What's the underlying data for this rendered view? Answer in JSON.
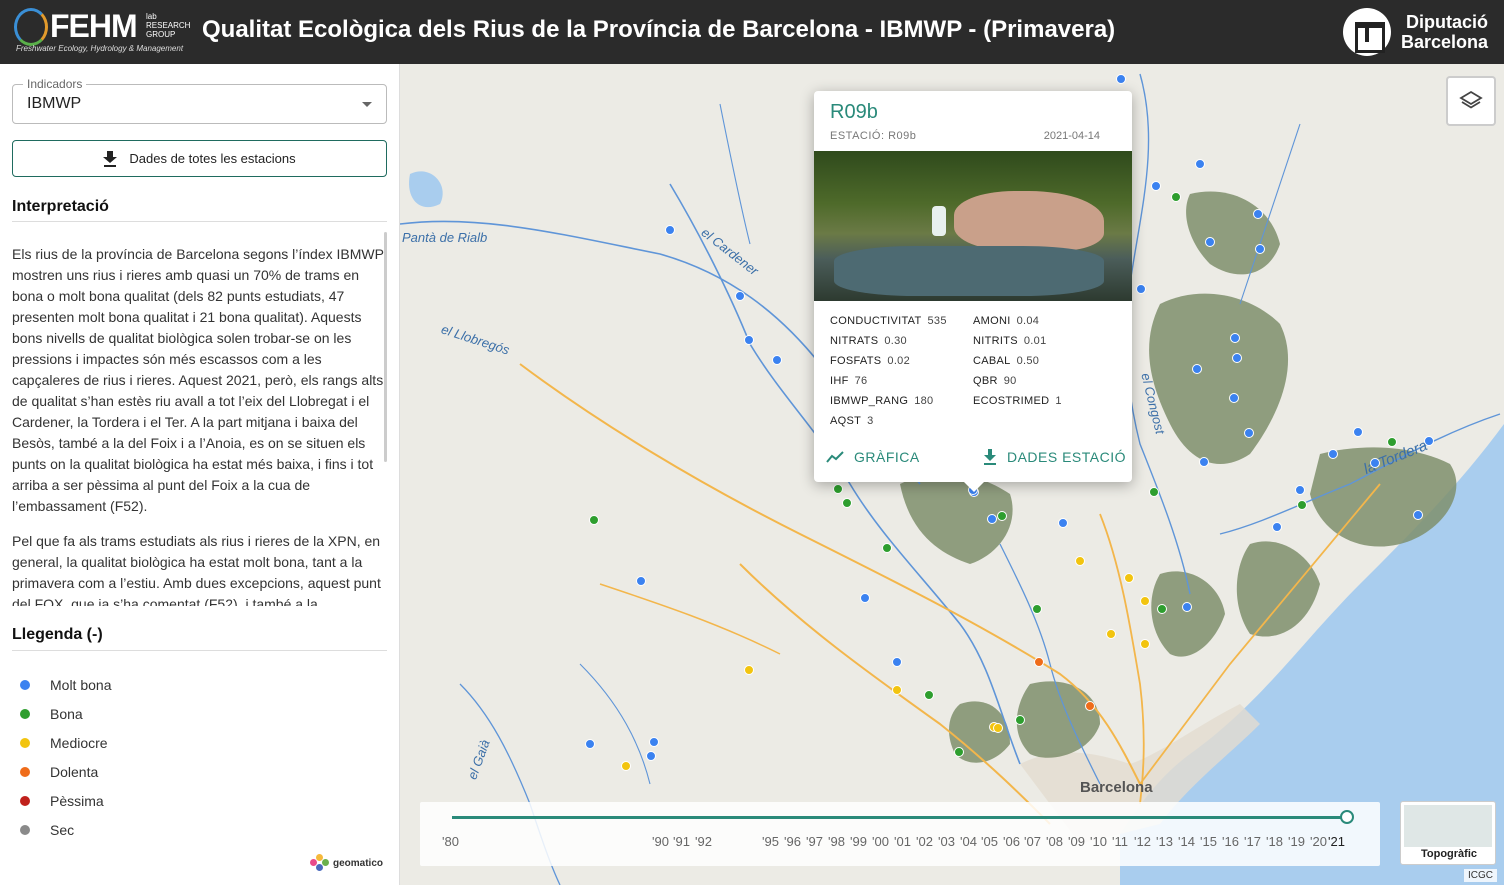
{
  "header": {
    "logo_text": "FEHM",
    "logo_lab": "lab\nRESEARCH\nGROUP",
    "logo_sub": "Freshwater Ecology, Hydrology & Management",
    "title": "Qualitat Ecològica dels Rius de la Província de Barcelona - IBMWP - (Primavera)",
    "brand_line1": "Diputació",
    "brand_line2": "Barcelona"
  },
  "sidebar": {
    "indicator_label": "Indicadors",
    "indicator_value": "IBMWP",
    "download_all_label": "Dades de totes les estacions",
    "interpretation_title": "Interpretació",
    "interpretation_paragraphs": [
      "Els rius de la província de Barcelona segons l’índex IBMWP mostren uns rius i rieres amb quasi un 70% de trams en bona o molt bona qualitat (dels 82 punts estudiats, 47 presenten molt bona qualitat i 21 bona qualitat). Aquests bons nivells de qualitat biològica solen trobar-se on les pressions i impactes són més escassos com a les capçaleres de rius i rieres. Aquest 2021, però, els rangs alts de qualitat s’han estès riu avall a tot l’eix del Llobregat i el Cardener, la Tordera i el Ter. A la part mitjana i baixa del Besòs, també a la del Foix i a l’Anoia, es on se situen els punts on la qualitat biològica ha estat més baixa, i fins i tot arriba a ser pèssima al punt del Foix a la cua de l’embassament (F52).",
      "Pel que fa als trams estudiats als rius i rieres de la XPN, en general, la qualitat biològica ha estat molt bona, tant a la primavera com a l’estiu. Amb dues excepcions, aquest punt del FOX, que ja s’ha comentat (F52), i també a la"
    ],
    "legend_title": "Llegenda (-)",
    "legend": [
      {
        "label": "Molt bona",
        "color": "#3b82f0"
      },
      {
        "label": "Bona",
        "color": "#2e9e2e"
      },
      {
        "label": "Mediocre",
        "color": "#f2c40f"
      },
      {
        "label": "Dolenta",
        "color": "#ef6c1a"
      },
      {
        "label": "Pèssima",
        "color": "#c0211c"
      },
      {
        "label": "Sec",
        "color": "#8a8a8a"
      }
    ],
    "credit": "geomatico"
  },
  "map": {
    "place_labels": [
      "Pantà de Rialb",
      "el Cardener",
      "el Llobregós",
      "el Gaià",
      "el Congost",
      "la Tordera"
    ],
    "city": "Barcelona",
    "attribution": "ICGC",
    "basemap_button": "Topogràfic",
    "colors": {
      "sea": "#a9cdee",
      "land": "#ecebe5",
      "forest": "#7f8f6c",
      "river": "#5f95d8",
      "road": "#f3b64b"
    }
  },
  "popup": {
    "title": "R09b",
    "station_label": "ESTACIÓ: R09b",
    "date": "2021-04-14",
    "properties": [
      {
        "key": "CONDUCTIVITAT",
        "value": "535"
      },
      {
        "key": "AMONI",
        "value": "0.04"
      },
      {
        "key": "NITRATS",
        "value": "0.30"
      },
      {
        "key": "NITRITS",
        "value": "0.01"
      },
      {
        "key": "FOSFATS",
        "value": "0.02"
      },
      {
        "key": "CABAL",
        "value": "0.50"
      },
      {
        "key": "IHF",
        "value": "76"
      },
      {
        "key": "QBR",
        "value": "90"
      },
      {
        "key": "IBMWP_RANG",
        "value": "180"
      },
      {
        "key": "ECOSTRIMED",
        "value": "1"
      },
      {
        "key": "AQST",
        "value": "3"
      }
    ],
    "chart_button": "GRÀFICA",
    "data_button": "DADES ESTACIÓ"
  },
  "timeline": {
    "years": [
      "'80",
      "'90",
      "'91",
      "'92",
      "'95",
      "'96",
      "'97",
      "'98",
      "'99",
      "'00",
      "'01",
      "'02",
      "'03",
      "'04",
      "'05",
      "'06",
      "'07",
      "'08",
      "'09",
      "'10",
      "'11",
      "'12",
      "'13",
      "'14",
      "'15",
      "'16",
      "'17",
      "'18",
      "'19",
      "'20",
      "'21"
    ],
    "selected": "'21"
  }
}
